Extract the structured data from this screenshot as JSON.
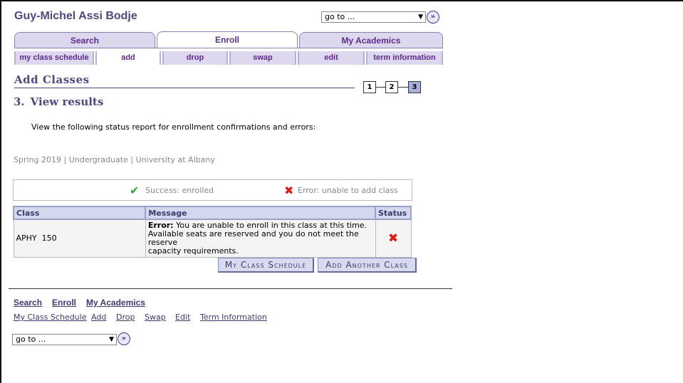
{
  "header": {
    "student_name": "Guy-Michel Assi Bodje",
    "goto_label": "go to ...",
    "goto_button_icon": "double-chevron-right"
  },
  "tabs": [
    {
      "label": "Search"
    },
    {
      "label": "Enroll",
      "active": true
    },
    {
      "label": "My Academics"
    }
  ],
  "subtabs": [
    {
      "label": "my class schedule"
    },
    {
      "label": "add",
      "active": true
    },
    {
      "label": "drop"
    },
    {
      "label": "swap"
    },
    {
      "label": "edit"
    },
    {
      "label": "term information"
    }
  ],
  "page": {
    "title": "Add Classes",
    "steps": [
      "1",
      "2",
      "3"
    ],
    "current_step": 3,
    "step_number": "3.",
    "step_title": "View results",
    "intro": "View the following status report for enrollment confirmations and errors:",
    "term": "Spring 2019 | Undergraduate | University at Albany"
  },
  "legend": {
    "success": "Success: enrolled",
    "error": "Error: unable to add class",
    "success_color": "#2eaa2e",
    "error_color": "#d81b1b"
  },
  "results": {
    "headers": [
      "Class",
      "Message",
      "Status"
    ],
    "rows": [
      {
        "class": "APHY  150",
        "message_label": "Error:",
        "message_line1": " You are unable to enroll in this class at this time.",
        "message_line2": "Available seats are reserved and you do not meet the reserve",
        "message_line3": "capacity requirements.",
        "status_icon": "error-x"
      }
    ]
  },
  "buttons": {
    "my_class_schedule": "My Class Schedule",
    "add_another_class": "Add Another Class"
  },
  "footer": {
    "main_links": [
      "Search",
      "Enroll",
      "My Academics"
    ],
    "sub_links": [
      "My Class Schedule",
      "Add",
      "Drop",
      "Swap",
      "Edit",
      "Term Information"
    ],
    "goto_label": "go to ..."
  }
}
